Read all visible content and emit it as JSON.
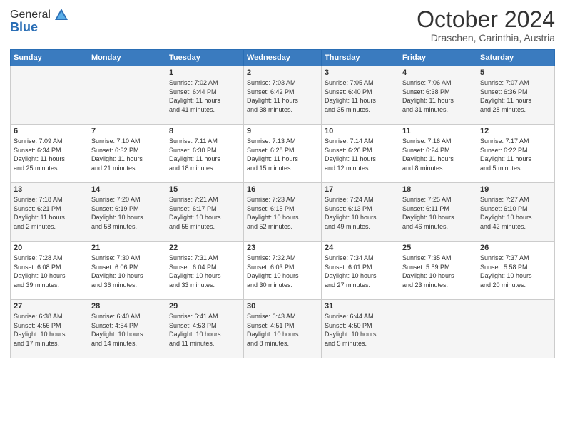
{
  "header": {
    "logo_general": "General",
    "logo_blue": "Blue",
    "month": "October 2024",
    "location": "Draschen, Carinthia, Austria"
  },
  "days_of_week": [
    "Sunday",
    "Monday",
    "Tuesday",
    "Wednesday",
    "Thursday",
    "Friday",
    "Saturday"
  ],
  "weeks": [
    [
      {
        "day": "",
        "lines": []
      },
      {
        "day": "",
        "lines": []
      },
      {
        "day": "1",
        "lines": [
          "Sunrise: 7:02 AM",
          "Sunset: 6:44 PM",
          "Daylight: 11 hours",
          "and 41 minutes."
        ]
      },
      {
        "day": "2",
        "lines": [
          "Sunrise: 7:03 AM",
          "Sunset: 6:42 PM",
          "Daylight: 11 hours",
          "and 38 minutes."
        ]
      },
      {
        "day": "3",
        "lines": [
          "Sunrise: 7:05 AM",
          "Sunset: 6:40 PM",
          "Daylight: 11 hours",
          "and 35 minutes."
        ]
      },
      {
        "day": "4",
        "lines": [
          "Sunrise: 7:06 AM",
          "Sunset: 6:38 PM",
          "Daylight: 11 hours",
          "and 31 minutes."
        ]
      },
      {
        "day": "5",
        "lines": [
          "Sunrise: 7:07 AM",
          "Sunset: 6:36 PM",
          "Daylight: 11 hours",
          "and 28 minutes."
        ]
      }
    ],
    [
      {
        "day": "6",
        "lines": [
          "Sunrise: 7:09 AM",
          "Sunset: 6:34 PM",
          "Daylight: 11 hours",
          "and 25 minutes."
        ]
      },
      {
        "day": "7",
        "lines": [
          "Sunrise: 7:10 AM",
          "Sunset: 6:32 PM",
          "Daylight: 11 hours",
          "and 21 minutes."
        ]
      },
      {
        "day": "8",
        "lines": [
          "Sunrise: 7:11 AM",
          "Sunset: 6:30 PM",
          "Daylight: 11 hours",
          "and 18 minutes."
        ]
      },
      {
        "day": "9",
        "lines": [
          "Sunrise: 7:13 AM",
          "Sunset: 6:28 PM",
          "Daylight: 11 hours",
          "and 15 minutes."
        ]
      },
      {
        "day": "10",
        "lines": [
          "Sunrise: 7:14 AM",
          "Sunset: 6:26 PM",
          "Daylight: 11 hours",
          "and 12 minutes."
        ]
      },
      {
        "day": "11",
        "lines": [
          "Sunrise: 7:16 AM",
          "Sunset: 6:24 PM",
          "Daylight: 11 hours",
          "and 8 minutes."
        ]
      },
      {
        "day": "12",
        "lines": [
          "Sunrise: 7:17 AM",
          "Sunset: 6:22 PM",
          "Daylight: 11 hours",
          "and 5 minutes."
        ]
      }
    ],
    [
      {
        "day": "13",
        "lines": [
          "Sunrise: 7:18 AM",
          "Sunset: 6:21 PM",
          "Daylight: 11 hours",
          "and 2 minutes."
        ]
      },
      {
        "day": "14",
        "lines": [
          "Sunrise: 7:20 AM",
          "Sunset: 6:19 PM",
          "Daylight: 10 hours",
          "and 58 minutes."
        ]
      },
      {
        "day": "15",
        "lines": [
          "Sunrise: 7:21 AM",
          "Sunset: 6:17 PM",
          "Daylight: 10 hours",
          "and 55 minutes."
        ]
      },
      {
        "day": "16",
        "lines": [
          "Sunrise: 7:23 AM",
          "Sunset: 6:15 PM",
          "Daylight: 10 hours",
          "and 52 minutes."
        ]
      },
      {
        "day": "17",
        "lines": [
          "Sunrise: 7:24 AM",
          "Sunset: 6:13 PM",
          "Daylight: 10 hours",
          "and 49 minutes."
        ]
      },
      {
        "day": "18",
        "lines": [
          "Sunrise: 7:25 AM",
          "Sunset: 6:11 PM",
          "Daylight: 10 hours",
          "and 46 minutes."
        ]
      },
      {
        "day": "19",
        "lines": [
          "Sunrise: 7:27 AM",
          "Sunset: 6:10 PM",
          "Daylight: 10 hours",
          "and 42 minutes."
        ]
      }
    ],
    [
      {
        "day": "20",
        "lines": [
          "Sunrise: 7:28 AM",
          "Sunset: 6:08 PM",
          "Daylight: 10 hours",
          "and 39 minutes."
        ]
      },
      {
        "day": "21",
        "lines": [
          "Sunrise: 7:30 AM",
          "Sunset: 6:06 PM",
          "Daylight: 10 hours",
          "and 36 minutes."
        ]
      },
      {
        "day": "22",
        "lines": [
          "Sunrise: 7:31 AM",
          "Sunset: 6:04 PM",
          "Daylight: 10 hours",
          "and 33 minutes."
        ]
      },
      {
        "day": "23",
        "lines": [
          "Sunrise: 7:32 AM",
          "Sunset: 6:03 PM",
          "Daylight: 10 hours",
          "and 30 minutes."
        ]
      },
      {
        "day": "24",
        "lines": [
          "Sunrise: 7:34 AM",
          "Sunset: 6:01 PM",
          "Daylight: 10 hours",
          "and 27 minutes."
        ]
      },
      {
        "day": "25",
        "lines": [
          "Sunrise: 7:35 AM",
          "Sunset: 5:59 PM",
          "Daylight: 10 hours",
          "and 23 minutes."
        ]
      },
      {
        "day": "26",
        "lines": [
          "Sunrise: 7:37 AM",
          "Sunset: 5:58 PM",
          "Daylight: 10 hours",
          "and 20 minutes."
        ]
      }
    ],
    [
      {
        "day": "27",
        "lines": [
          "Sunrise: 6:38 AM",
          "Sunset: 4:56 PM",
          "Daylight: 10 hours",
          "and 17 minutes."
        ]
      },
      {
        "day": "28",
        "lines": [
          "Sunrise: 6:40 AM",
          "Sunset: 4:54 PM",
          "Daylight: 10 hours",
          "and 14 minutes."
        ]
      },
      {
        "day": "29",
        "lines": [
          "Sunrise: 6:41 AM",
          "Sunset: 4:53 PM",
          "Daylight: 10 hours",
          "and 11 minutes."
        ]
      },
      {
        "day": "30",
        "lines": [
          "Sunrise: 6:43 AM",
          "Sunset: 4:51 PM",
          "Daylight: 10 hours",
          "and 8 minutes."
        ]
      },
      {
        "day": "31",
        "lines": [
          "Sunrise: 6:44 AM",
          "Sunset: 4:50 PM",
          "Daylight: 10 hours",
          "and 5 minutes."
        ]
      },
      {
        "day": "",
        "lines": []
      },
      {
        "day": "",
        "lines": []
      }
    ]
  ]
}
